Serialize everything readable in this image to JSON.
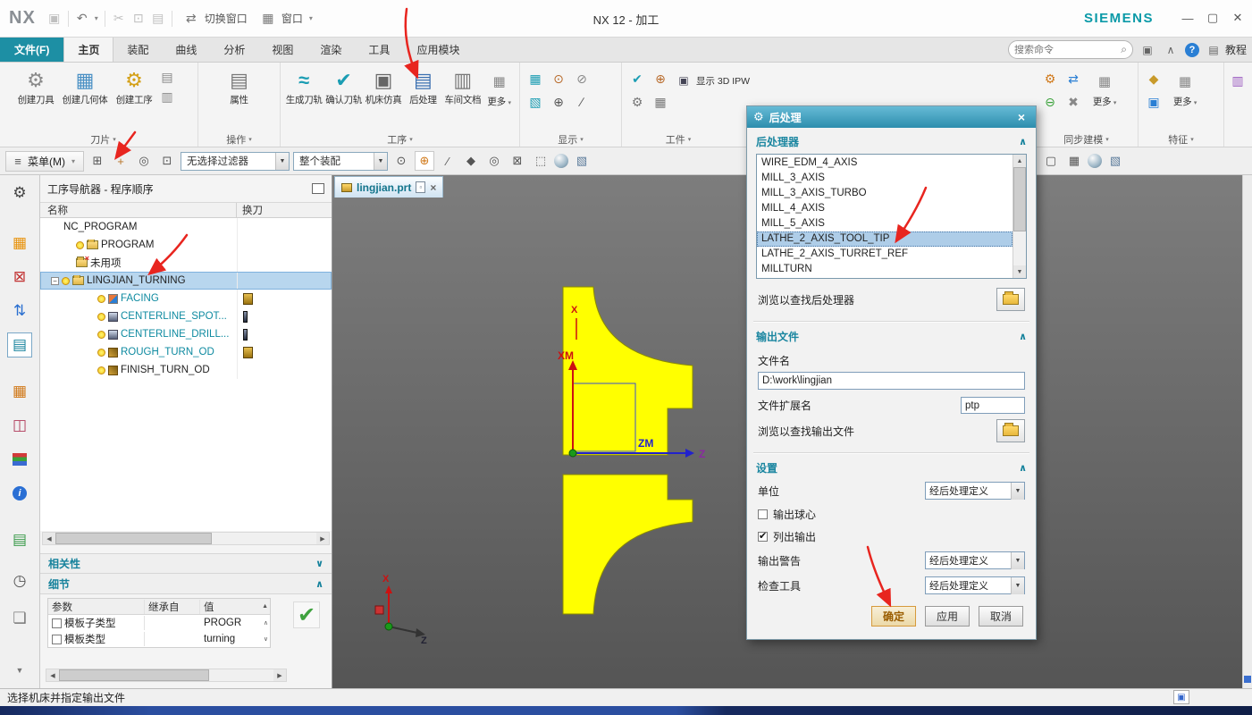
{
  "titlebar": {
    "logo": "NX",
    "title": "NX 12 - 加工",
    "brand": "SIEMENS",
    "switch_window": "切换窗口",
    "window": "窗口"
  },
  "tabs": {
    "file": "文件(F)",
    "items": [
      "主页",
      "装配",
      "曲线",
      "分析",
      "视图",
      "渲染",
      "工具",
      "应用模块"
    ],
    "search_placeholder": "搜索命令",
    "tutorial": "教程"
  },
  "ribbon": {
    "insert_group": {
      "label": "刀片",
      "create_tool": "创建刀具",
      "create_geometry": "创建几何体",
      "create_operation": "创建工序"
    },
    "operation_group": {
      "label": "操作",
      "properties": "属性"
    },
    "toolpath_group": {
      "label": "工序",
      "generate": "生成刀轨",
      "verify": "确认刀轨",
      "simulate": "机床仿真",
      "postprocess": "后处理",
      "shop_doc": "车间文档",
      "more": "更多"
    },
    "display_group": {
      "label": "显示"
    },
    "workpiece_group": {
      "label": "工件",
      "show_ipw": "显示 3D IPW"
    },
    "sync_group": {
      "label": "同步建模",
      "more": "更多"
    },
    "feature_group": {
      "label": "特征",
      "more": "更多"
    }
  },
  "menubar": {
    "menu": "菜单(M)",
    "selection_filter": "无选择过滤器",
    "scope": "整个装配"
  },
  "navigator": {
    "title": "工序导航器 - 程序顺序",
    "col_name": "名称",
    "col_toolchange": "换刀",
    "rows": [
      {
        "label": "NC_PROGRAM"
      },
      {
        "label": "PROGRAM"
      },
      {
        "label": "未用项"
      },
      {
        "label": "LINGJIAN_TURNING"
      },
      {
        "label": "FACING"
      },
      {
        "label": "CENTERLINE_SPOT..."
      },
      {
        "label": "CENTERLINE_DRILL..."
      },
      {
        "label": "ROUGH_TURN_OD"
      },
      {
        "label": "FINISH_TURN_OD"
      }
    ],
    "dependencies": "相关性",
    "details": "细节",
    "details_cols": [
      "参数",
      "继承自",
      "值"
    ],
    "details_rows": [
      {
        "param": "模板子类型",
        "value": "PROGR"
      },
      {
        "param": "模板类型",
        "value": "turning"
      }
    ]
  },
  "viewport": {
    "tab": "lingjian.prt",
    "labels": {
      "x": "X",
      "xm": "XM",
      "zm": "ZM",
      "z": "Z",
      "triad_x": "X",
      "triad_z": "Z"
    }
  },
  "dialog": {
    "title": "后处理",
    "post_section": "后处理器",
    "post_list": [
      "WIRE_EDM_4_AXIS",
      "MILL_3_AXIS",
      "MILL_3_AXIS_TURBO",
      "MILL_4_AXIS",
      "MILL_5_AXIS",
      "LATHE_2_AXIS_TOOL_TIP",
      "LATHE_2_AXIS_TURRET_REF",
      "MILLTURN"
    ],
    "selected_post": "LATHE_2_AXIS_TOOL_TIP",
    "browse_post": "浏览以查找后处理器",
    "output_section": "输出文件",
    "filename_label": "文件名",
    "filename": "D:\\work\\lingjian",
    "ext_label": "文件扩展名",
    "ext": "ptp",
    "browse_output": "浏览以查找输出文件",
    "settings_section": "设置",
    "units_label": "单位",
    "units": "经后处理定义",
    "ball_center": "输出球心",
    "list_output": "列出输出",
    "warning_label": "输出警告",
    "warning": "经后处理定义",
    "check_label": "检查工具",
    "check": "经后处理定义",
    "ok": "确定",
    "apply": "应用",
    "cancel": "取消"
  },
  "statusbar": {
    "message": "选择机床并指定输出文件"
  },
  "colors": {
    "accent_teal": "#1b8a9e",
    "selection": "#b8d6ee",
    "part_yellow": "#ffff00",
    "annotation_red": "#e8251f"
  }
}
